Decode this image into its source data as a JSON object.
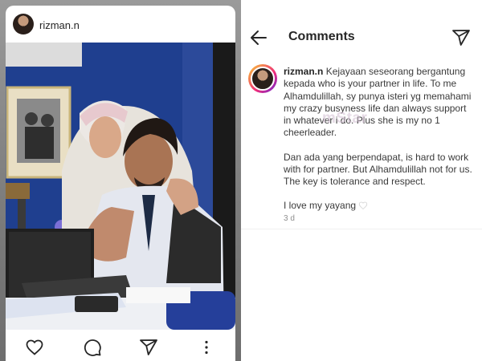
{
  "post": {
    "username": "rizman.n",
    "avatar_icon": "profile-avatar",
    "actions": [
      {
        "icon": "heart-icon"
      },
      {
        "icon": "comment-icon"
      },
      {
        "icon": "share-icon"
      },
      {
        "icon": "more-icon"
      }
    ]
  },
  "comments": {
    "title": "Comments",
    "back_icon": "back-arrow-icon",
    "send_icon": "send-icon",
    "caption": {
      "username": "rizman.n",
      "text_1": "Kejayaan seseorang bergantung kepada who is your partner in life. To me Alhamdulillah, sy punya isteri yg memahami my crazy busyness life dan always support in whatever i do. Plus she is my no 1 cheerleader.",
      "text_2": "Dan ada yang berpendapat, is hard to work with for partner. But Alhamdulillah not for us. The key is tolerance and respect.",
      "text_3": "I love my yayang",
      "emoji": "white-heart",
      "time": "3 d"
    }
  },
  "watermark": "mStar",
  "colors": {
    "text": "#262626",
    "muted": "#8e8e8e",
    "wall_blue": "#1f3f8f"
  }
}
